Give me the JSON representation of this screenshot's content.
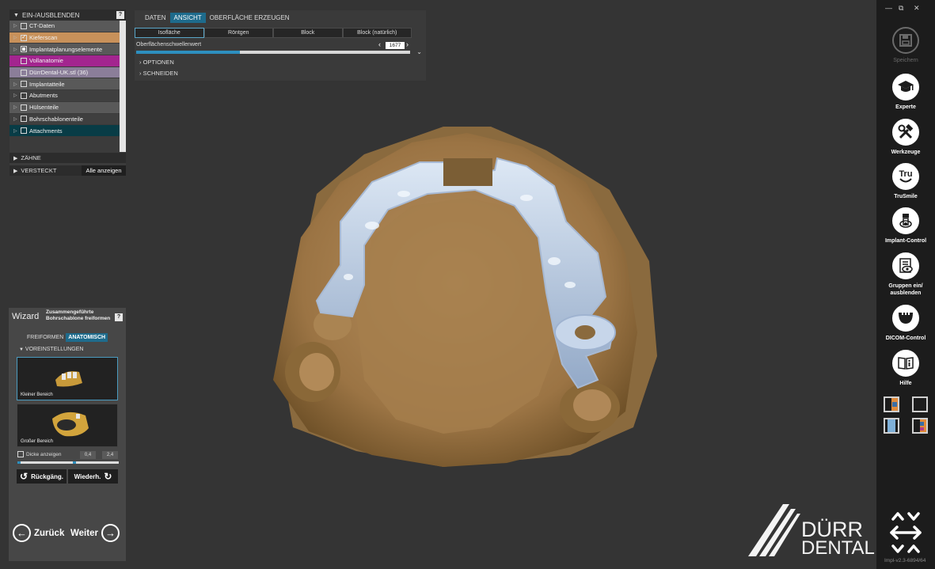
{
  "visibility_panel": {
    "title": "EIN-/AUSBLENDEN",
    "help": "?",
    "layers": [
      {
        "label": "CT-Daten",
        "state": "unchecked",
        "expander": true,
        "bg": "#595959"
      },
      {
        "label": "Kieferscan",
        "state": "checked",
        "expander": true,
        "bg": "#c8915a"
      },
      {
        "label": "Implantatplanungselemente",
        "state": "partial",
        "expander": true,
        "bg": "#595959"
      },
      {
        "label": "Vollanatomie",
        "state": "unchecked",
        "expander": false,
        "bg": "#a3258f"
      },
      {
        "label": "DürrDental-UK.stl (36)",
        "state": "unchecked",
        "expander": false,
        "bg": "#8b7e99"
      },
      {
        "label": "Implantatteile",
        "state": "unchecked",
        "expander": true,
        "bg": "#595959"
      },
      {
        "label": "Abutments",
        "state": "unchecked",
        "expander": true,
        "bg": "#3f3f3f"
      },
      {
        "label": "Hülsenteile",
        "state": "unchecked",
        "expander": true,
        "bg": "#595959"
      },
      {
        "label": "Bohrschablonenteile",
        "state": "unchecked",
        "expander": true,
        "bg": "#3f3f3f"
      },
      {
        "label": "Attachments",
        "state": "unchecked",
        "expander": true,
        "bg": "#083c46"
      }
    ],
    "teeth_label": "ZÄHNE",
    "hidden_label": "VERSTECKT",
    "show_all": "Alle anzeigen"
  },
  "properties": {
    "tabs": [
      "DATEN",
      "ANSICHT",
      "OBERFLÄCHE ERZEUGEN"
    ],
    "active_tab": 1,
    "modes": [
      "Isofläche",
      "Röntgen",
      "Block",
      "Block (natürlich)"
    ],
    "active_mode": 0,
    "threshold_label": "Oberflächenschwellenwert",
    "threshold_value": "1677",
    "threshold_fraction": 0.38,
    "section_options": "OPTIONEN",
    "section_cut": "SCHNEIDEN"
  },
  "wizard": {
    "title": "Wizard",
    "subtitle": "Zusammengeführte Bohrschablone freiformen",
    "help": "?",
    "tabs": [
      "FREIFORMEN",
      "ANATOMISCH"
    ],
    "active_tab": 1,
    "section": "VOREINSTELLUNGEN",
    "presets": [
      "Kleiner Bereich",
      "Großer Bereich"
    ],
    "active_preset": 0,
    "thickness_label": "Dicke anzeigen",
    "thickness_min": "0,4",
    "thickness_max": "2,4",
    "undo": "Rückgäng.",
    "redo": "Wiederh.",
    "back": "Zurück",
    "next": "Weiter"
  },
  "toolbar": {
    "window_controls": [
      "—",
      "⧉",
      "✕"
    ],
    "tools": [
      {
        "label": "Speichern",
        "icon": "save-icon",
        "disabled": true
      },
      {
        "label": "Experte",
        "icon": "graduation-cap-icon",
        "disabled": false
      },
      {
        "label": "Werkzeuge",
        "icon": "tools-icon",
        "disabled": false
      },
      {
        "label": "TruSmile",
        "icon": "trusmile-icon",
        "glyph": "Tru",
        "disabled": false
      },
      {
        "label": "Implant-Control",
        "icon": "implant-eye-icon",
        "disabled": false
      },
      {
        "label": "Gruppen ein/ ausblenden",
        "icon": "groups-eye-icon",
        "disabled": false
      },
      {
        "label": "DICOM-Control",
        "icon": "dicom-jaw-icon",
        "disabled": false
      },
      {
        "label": "Hilfe",
        "icon": "help-book-icon",
        "disabled": false
      }
    ],
    "version": "Impl-v2.3-6894/64"
  },
  "logo": {
    "line1": "DÜRR",
    "line2": "DENTAL"
  }
}
